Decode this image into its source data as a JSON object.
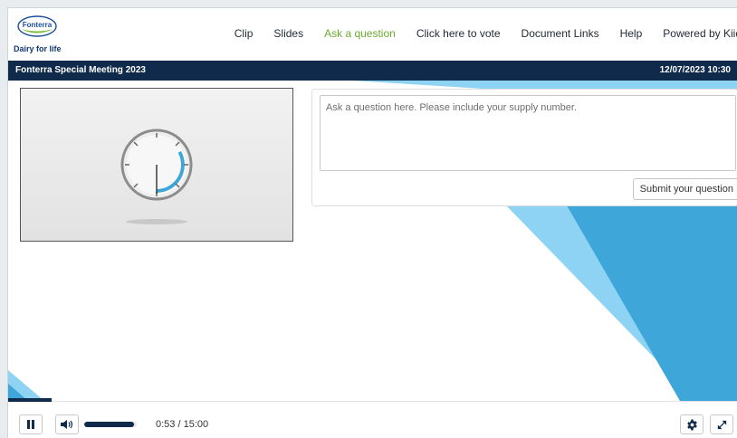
{
  "header": {
    "logo_text": "Fonterra",
    "tagline": "Dairy for life",
    "nav": [
      {
        "label": "Clip",
        "name": "nav-clip",
        "active": false
      },
      {
        "label": "Slides",
        "name": "nav-slides",
        "active": false
      },
      {
        "label": "Ask a question",
        "name": "nav-ask-question",
        "active": true
      },
      {
        "label": "Click here to vote",
        "name": "nav-vote",
        "active": false
      },
      {
        "label": "Document Links",
        "name": "nav-document-links",
        "active": false
      },
      {
        "label": "Help",
        "name": "nav-help",
        "active": false
      },
      {
        "label": "Powered by Kiid",
        "name": "nav-powered-by",
        "active": false
      }
    ]
  },
  "titlebar": {
    "title": "Fonterra Special Meeting 2023",
    "datetime": "12/07/2023 10:30"
  },
  "question": {
    "placeholder": "Ask a question here. Please include your supply number.",
    "value": "",
    "submit_label": "Submit your question"
  },
  "player": {
    "current_time": "0:53",
    "separator": " / ",
    "duration": "15:00",
    "playback_progress": 0.059,
    "volume_level": 0.95
  },
  "icons": {
    "pause": "pause-icon",
    "volume": "volume-icon",
    "settings": "gear-icon",
    "fullscreen": "expand-icon",
    "clock": "clock-icon"
  },
  "colors": {
    "navy": "#0f2a4a",
    "accent_green": "#6aaa2f",
    "accent_blue": "#3ea6d8",
    "light_blue": "#8fd3f4"
  }
}
